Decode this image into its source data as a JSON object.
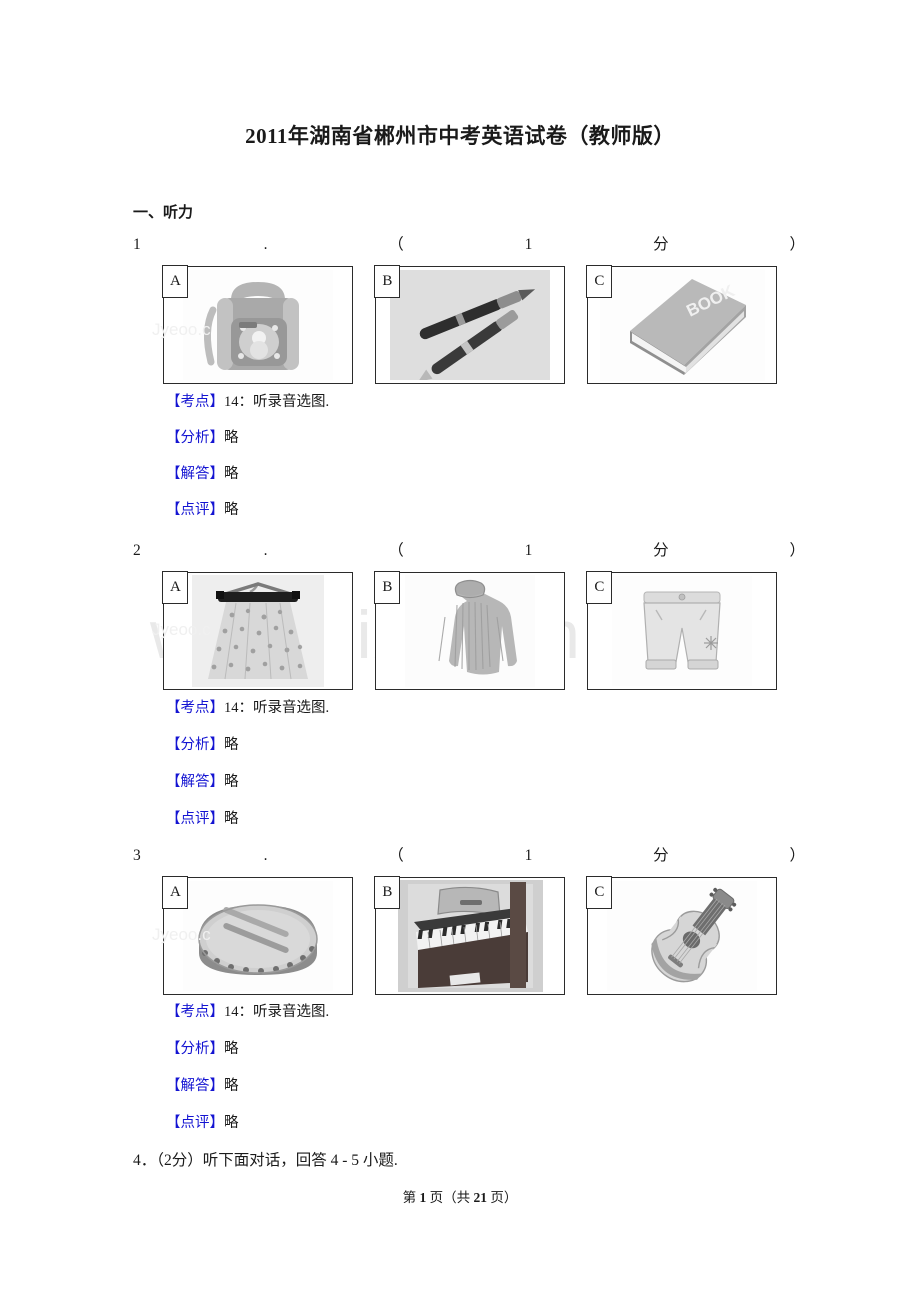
{
  "document": {
    "title": "2011年湖南省郴州市中考英语试卷（教师版）",
    "section_heading": "一、听力"
  },
  "watermarks": {
    "big": "www.zixi      com.cn",
    "small": "Jyeoo.c"
  },
  "question_line": {
    "dot": ".",
    "paren_open": "（",
    "score": "1",
    "score_unit": "分",
    "paren_close": "）"
  },
  "questions": [
    {
      "number": "1",
      "options": [
        {
          "letter": "A",
          "icon": "backpack-image"
        },
        {
          "letter": "B",
          "icon": "fountain-pens-image"
        },
        {
          "letter": "C",
          "icon": "book-image"
        }
      ],
      "explanation": [
        {
          "label": "【考点】",
          "text": "14：听录音选图."
        },
        {
          "label": "【分析】",
          "text": "略"
        },
        {
          "label": "【解答】",
          "text": "略"
        },
        {
          "label": "【点评】",
          "text": "略"
        }
      ]
    },
    {
      "number": "2",
      "options": [
        {
          "letter": "A",
          "icon": "skirt-image"
        },
        {
          "letter": "B",
          "icon": "sweater-image"
        },
        {
          "letter": "C",
          "icon": "shorts-image"
        }
      ],
      "explanation": [
        {
          "label": "【考点】",
          "text": "14：听录音选图."
        },
        {
          "label": "【分析】",
          "text": "略"
        },
        {
          "label": "【解答】",
          "text": "略"
        },
        {
          "label": "【点评】",
          "text": "略"
        }
      ]
    },
    {
      "number": "3",
      "options": [
        {
          "letter": "A",
          "icon": "drum-image"
        },
        {
          "letter": "B",
          "icon": "piano-image"
        },
        {
          "letter": "C",
          "icon": "guitar-image"
        }
      ],
      "explanation": [
        {
          "label": "【考点】",
          "text": "14：听录音选图."
        },
        {
          "label": "【分析】",
          "text": "略"
        },
        {
          "label": "【解答】",
          "text": "略"
        },
        {
          "label": "【点评】",
          "text": "略"
        }
      ]
    }
  ],
  "question4": "4．（2分）听下面对话，回答 4 - 5 小题.",
  "footer": {
    "prefix": "第",
    "page": "1",
    "middle": "页（共",
    "total": "21",
    "suffix": "页）"
  },
  "book_cover_text": "BOOK",
  "colors": {
    "label_blue": "#1414d2",
    "text_black": "#1a1a1a",
    "border": "#2b2b2b"
  }
}
